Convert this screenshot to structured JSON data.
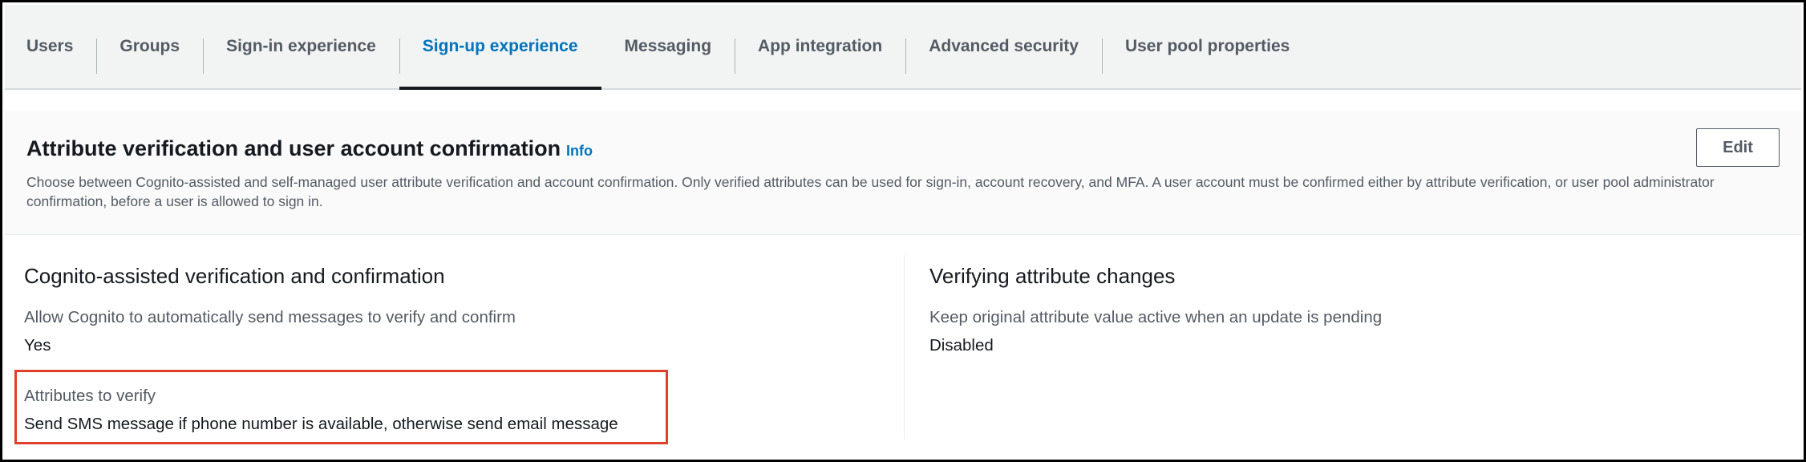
{
  "tabs": [
    {
      "label": "Users",
      "active": false
    },
    {
      "label": "Groups",
      "active": false
    },
    {
      "label": "Sign-in experience",
      "active": false
    },
    {
      "label": "Sign-up experience",
      "active": true
    },
    {
      "label": "Messaging",
      "active": false
    },
    {
      "label": "App integration",
      "active": false
    },
    {
      "label": "Advanced security",
      "active": false
    },
    {
      "label": "User pool properties",
      "active": false
    }
  ],
  "panel": {
    "title": "Attribute verification and user account confirmation",
    "info_label": "Info",
    "edit_label": "Edit",
    "description": "Choose between Cognito-assisted and self-managed user attribute verification and account confirmation. Only verified attributes can be used for sign-in, account recovery, and MFA. A user account must be confirmed either by attribute verification, or user pool administrator confirmation, before a user is allowed to sign in."
  },
  "left_column": {
    "title": "Cognito-assisted verification and confirmation",
    "auto_send_label": "Allow Cognito to automatically send messages to verify and confirm",
    "auto_send_value": "Yes",
    "attributes_label": "Attributes to verify",
    "attributes_value": "Send SMS message if phone number is available, otherwise send email message"
  },
  "right_column": {
    "title": "Verifying attribute changes",
    "keep_original_label": "Keep original attribute value active when an update is pending",
    "keep_original_value": "Disabled"
  },
  "colors": {
    "accent": "#0073bb",
    "highlight": "#e0402a",
    "text": "#16191f",
    "muted": "#545b64"
  }
}
